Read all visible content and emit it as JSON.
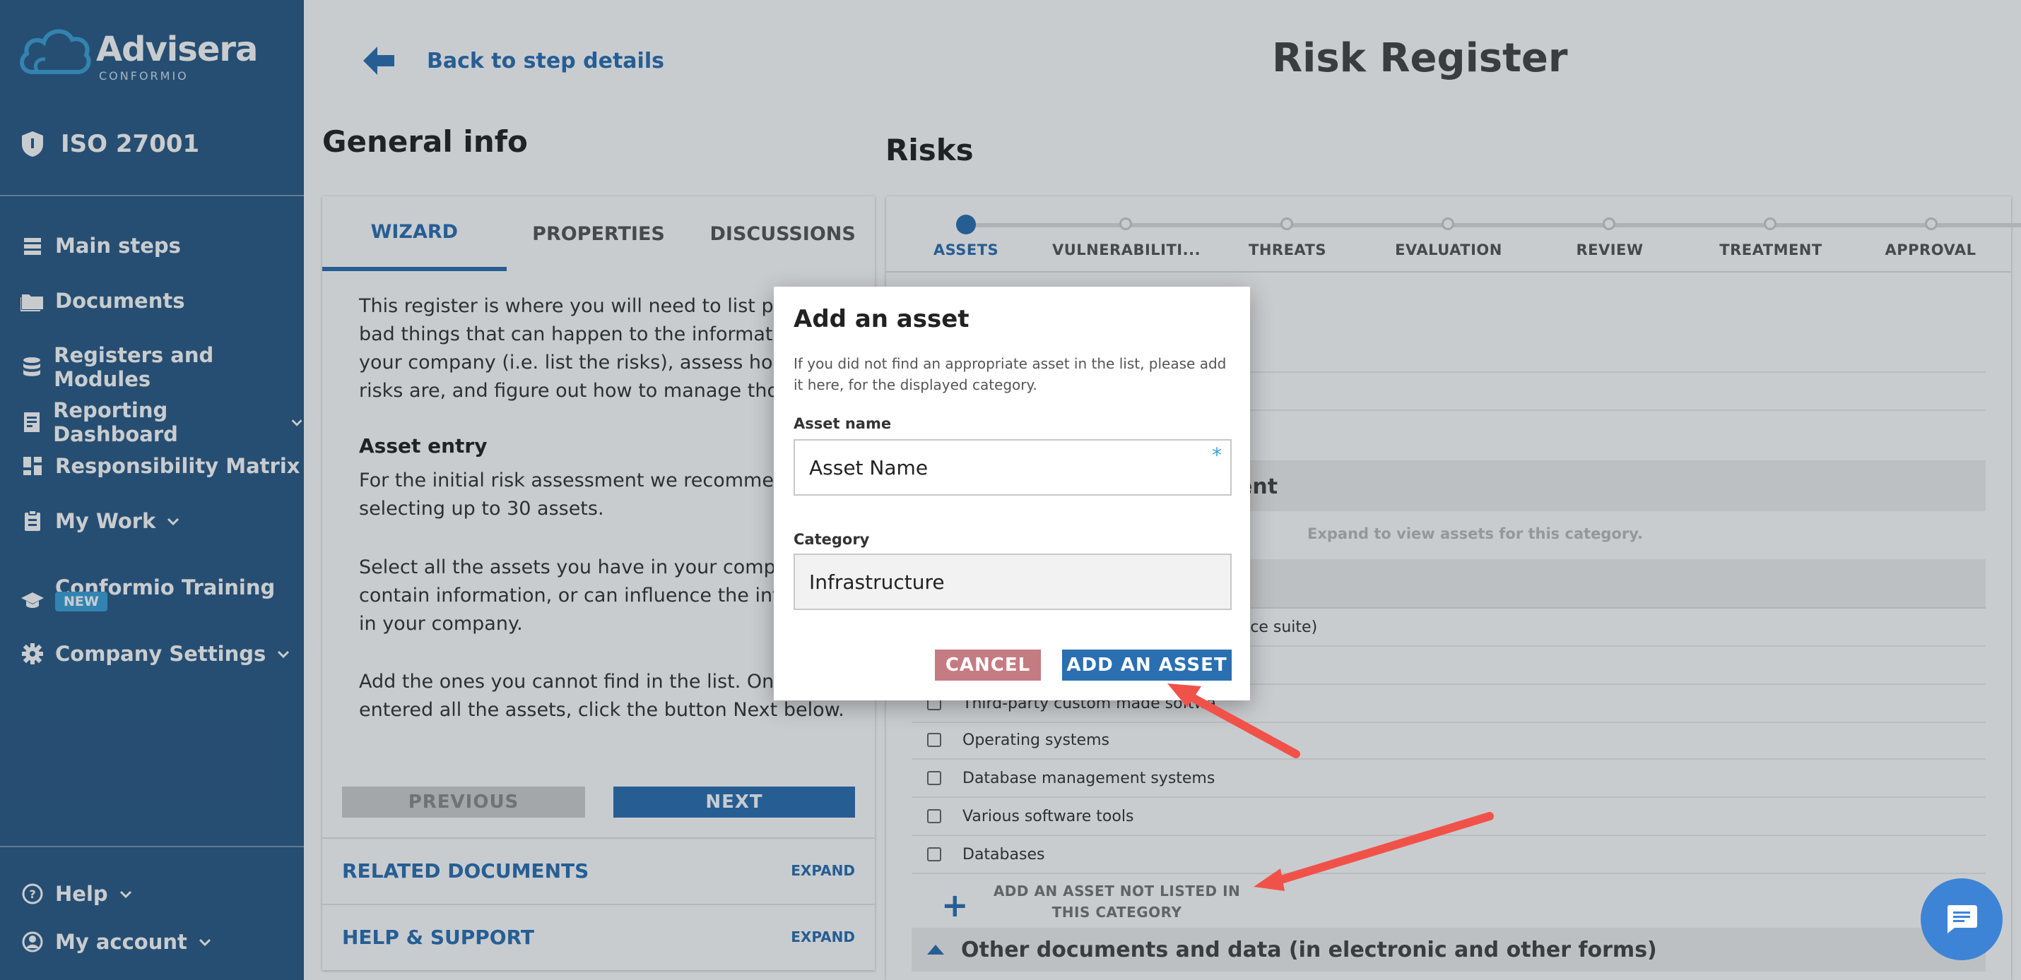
{
  "sidebar": {
    "logo_name": "Advisera",
    "logo_sub": "CONFORMIO",
    "standard": "ISO 27001",
    "items": [
      {
        "label": "Main steps"
      },
      {
        "label": "Documents"
      },
      {
        "label": "Registers and Modules"
      },
      {
        "label": "Reporting Dashboard"
      },
      {
        "label": "Responsibility Matrix"
      },
      {
        "label": "My Work"
      },
      {
        "label": "Conformio Training",
        "badge": "NEW"
      },
      {
        "label": "Company Settings"
      }
    ],
    "bottom": [
      {
        "label": "Help"
      },
      {
        "label": "My account"
      }
    ]
  },
  "header": {
    "back_label": "Back to step details",
    "title": "Risk Register"
  },
  "general": {
    "heading": "General info",
    "tabs": [
      "WIZARD",
      "PROPERTIES",
      "DISCUSSIONS"
    ],
    "paragraphs": [
      "This register is where you will need to list poter",
      "bad things that can happen to the information",
      "your company (i.e. list the risks), assess how big",
      "risks are, and figure out how to manage those"
    ],
    "asset_entry_title": "Asset entry",
    "asset_p1": [
      "For the initial risk assessment we recommend",
      "selecting up to 30 assets."
    ],
    "asset_p2": [
      "Select all the assets you have in your company",
      "contain information, or can influence the inform",
      "in your company."
    ],
    "asset_p3": [
      "Add the ones you cannot find in the list. Once y",
      "entered all the assets, click the button Next below."
    ],
    "prev_label": "PREVIOUS",
    "next_label": "NEXT",
    "related_docs": "RELATED DOCUMENTS",
    "help_support": "HELP & SUPPORT",
    "expand": "EXPAND"
  },
  "risks": {
    "heading": "Risks",
    "steps": [
      "ASSETS",
      "VULNERABILITI...",
      "THREATS",
      "EVALUATION",
      "REVIEW",
      "TREATMENT",
      "APPROVAL"
    ],
    "partial_category": "ent",
    "expand_note": "Expand to view assets for this category.",
    "partial_item": "ffice suite)",
    "items": [
      "Third-party custom made softwa",
      "Operating systems",
      "Database management systems",
      "Various software tools",
      "Databases"
    ],
    "add_not_listed": "ADD AN ASSET NOT LISTED IN THIS CATEGORY",
    "next_category": "Other documents and data (in electronic and other forms)"
  },
  "dialog": {
    "title": "Add an asset",
    "description": "If you did not find an appropriate asset in the list, please add it here, for the displayed category.",
    "asset_name_label": "Asset name",
    "asset_name_value": "Asset Name",
    "required_mark": "*",
    "category_label": "Category",
    "category_value": "Infrastructure",
    "cancel_label": "CANCEL",
    "add_label": "ADD AN ASSET"
  },
  "colors": {
    "sidebar": "#2a5a85",
    "accent": "#2a6fb2",
    "cancel": "#c57b82",
    "arrow": "#f0524a"
  }
}
